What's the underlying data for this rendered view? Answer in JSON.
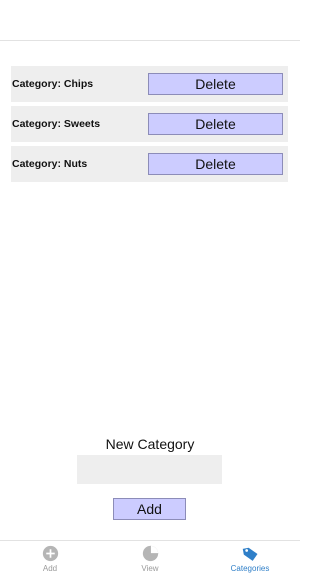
{
  "categories": [
    {
      "label": "Category: Chips",
      "delete_label": "Delete"
    },
    {
      "label": "Category: Sweets",
      "delete_label": "Delete"
    },
    {
      "label": "Category: Nuts",
      "delete_label": "Delete"
    }
  ],
  "new_category": {
    "title": "New Category",
    "input_value": "",
    "add_label": "Add"
  },
  "tabs": [
    {
      "label": "Add",
      "icon": "add-circle-icon",
      "active": false
    },
    {
      "label": "View",
      "icon": "pie-chart-icon",
      "active": false
    },
    {
      "label": "Categories",
      "icon": "tag-icon",
      "active": true
    }
  ],
  "colors": {
    "button_fill": "#ccccff",
    "row_fill": "#eeeeee",
    "active_tab": "#2f7fc8",
    "inactive_tab": "#9a9a9a"
  }
}
